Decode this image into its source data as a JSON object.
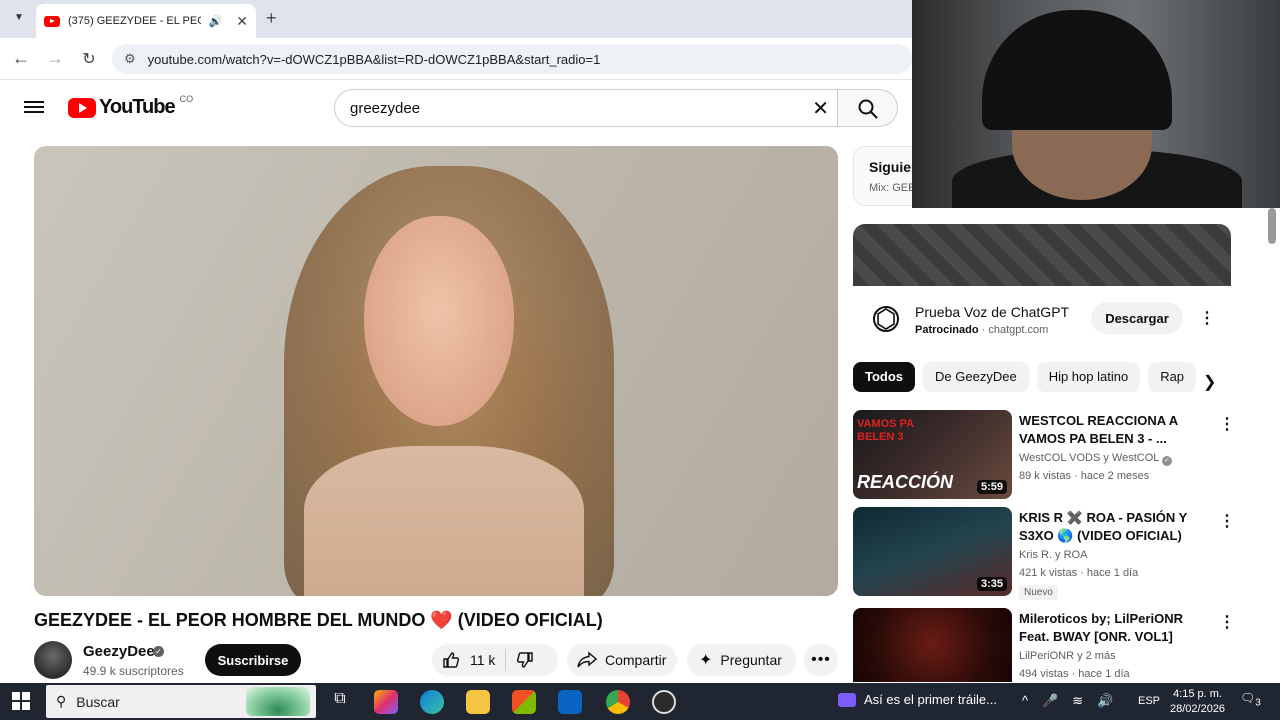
{
  "browser": {
    "tab_title": "(375) GEEZYDEE - EL PEOR",
    "url": "youtube.com/watch?v=-dOWCZ1pBBA&list=RD-dOWCZ1pBBA&start_radio=1"
  },
  "header": {
    "logo_text": "YouTube",
    "country_code": "CO",
    "search_value": "greezydee"
  },
  "video": {
    "title": "GEEZYDEE - EL PEOR HOMBRE DEL MUNDO ❤️ (VIDEO OFICIAL)",
    "channel": "GeezyDee",
    "subscribers": "49.9 k suscriptores",
    "subscribe_label": "Suscribirse",
    "likes": "11 k",
    "share_label": "Compartir",
    "ask_label": "Preguntar"
  },
  "up_next": {
    "title": "Siguien",
    "subtitle": "Mix: GEE"
  },
  "ad": {
    "title": "Prueba Voz de ChatGPT",
    "sponsored_label": "Patrocinado",
    "domain": "chatgpt.com",
    "cta": "Descargar"
  },
  "chips": [
    {
      "label": "Todos",
      "active": true
    },
    {
      "label": "De GeezyDee",
      "active": false
    },
    {
      "label": "Hip hop latino",
      "active": false
    },
    {
      "label": "Rap",
      "active": false
    }
  ],
  "recommendations": [
    {
      "title": "WESTCOL REACCIONA A VAMOS PA BELEN 3 - ...",
      "channel": "WestCOL VODS y WestCOL",
      "meta": "89 k vistas · hace 2 meses",
      "duration": "5:59",
      "thumb_text": "REACCIÓN",
      "thumb_caption": "VAMOS PA BELEN 3",
      "badge": ""
    },
    {
      "title": "KRIS R ✖️ ROA - PASIÓN Y S3XO 🌎 (VIDEO OFICIAL)",
      "channel": "Kris R. y ROA",
      "meta": "421 k vistas · hace 1 día",
      "duration": "3:35",
      "thumb_text": "",
      "thumb_caption": "",
      "badge": "Nuevo"
    },
    {
      "title": "Mileroticos by; LilPeriONR Feat. BWAY [ONR. VOL1]",
      "channel": "LilPeriONR y 2 más",
      "meta": "494 vistas · hace 1 día",
      "duration": "",
      "thumb_text": "",
      "thumb_caption": "",
      "badge": ""
    }
  ],
  "taskbar": {
    "search_placeholder": "Buscar",
    "media_title": "Así es el primer tráile...",
    "lang": "ESP",
    "time": "4:15 p. m.",
    "date": "28/02/2026",
    "notifications": "3"
  },
  "colors": {
    "brand_red": "#ff0000",
    "text_primary": "#0f0f0f",
    "text_secondary": "#606060",
    "chip_bg": "#f2f2f2",
    "taskbar_bg": "#1f2631"
  }
}
